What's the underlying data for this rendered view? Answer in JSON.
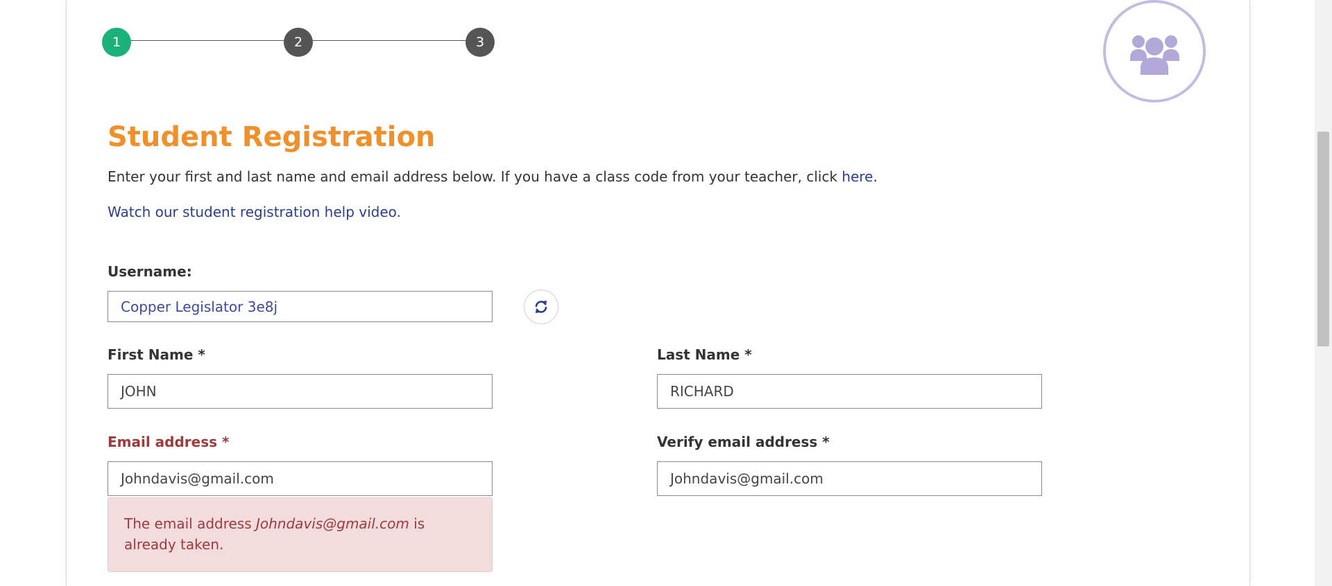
{
  "stepper": {
    "steps": [
      {
        "label": "1",
        "color": "#1ab27a"
      },
      {
        "label": "2",
        "color": "#555555"
      },
      {
        "label": "3",
        "color": "#555555"
      }
    ]
  },
  "header": {
    "title": "Student Registration",
    "intro_text": "Enter your first and last name and email address below. If you have a class code from your teacher, click ",
    "intro_link": "here",
    "intro_end": ".",
    "help_link": "Watch our student registration help video."
  },
  "form": {
    "username_label": "Username:",
    "username_value": "Copper Legislator 3e8j",
    "first_name_label": "First Name",
    "first_name_value": "JOHN",
    "last_name_label": "Last Name",
    "last_name_value": "RICHARD",
    "email_label": "Email address",
    "email_value": "Johndavis@gmail.com",
    "verify_email_label": "Verify email address",
    "verify_email_value": "Johndavis@gmail.com",
    "required_marker": "*"
  },
  "error": {
    "prefix": "The email address ",
    "email": "Johndavis@gmail.com",
    "suffix": " is already taken."
  },
  "colors": {
    "accent_orange": "#f0902a",
    "link_blue": "#2a3d8f",
    "error_red": "#a03a3a",
    "avatar_purple": "#b3a9d9"
  }
}
